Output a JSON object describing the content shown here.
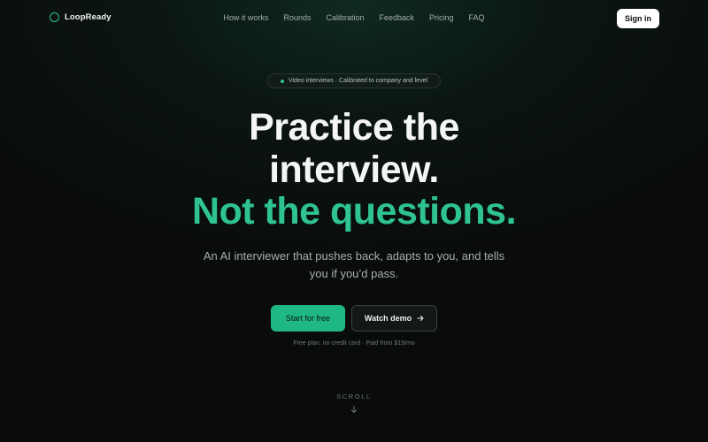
{
  "brand": {
    "name": "LoopReady",
    "icon": "ring-logo-icon",
    "accent": "#2fc48f"
  },
  "nav": {
    "links": [
      "How it works",
      "Rounds",
      "Calibration",
      "Feedback",
      "Pricing",
      "FAQ"
    ],
    "signin_label": "Sign in"
  },
  "hero": {
    "pill_text": "Video interviews · Calibrated to company and level",
    "headline_line1": "Practice the",
    "headline_line2": "interview.",
    "headline_line3": "Not the questions.",
    "sub_line1": "An AI interviewer that pushes back, adapts to you, and tells",
    "sub_line2": "you if you’d pass.",
    "cta_primary": "Start for free",
    "cta_secondary": "Watch demo",
    "cta_secondary_icon": "arrow-right-icon",
    "fineprint": "Free plan, no credit card · Paid from $19/mo"
  },
  "scroll": {
    "label": "SCROLL",
    "icon": "arrow-down-icon"
  },
  "colors": {
    "accent": "#2fc48f",
    "background": "#0a0c0c",
    "primary_button": "#20b882"
  }
}
